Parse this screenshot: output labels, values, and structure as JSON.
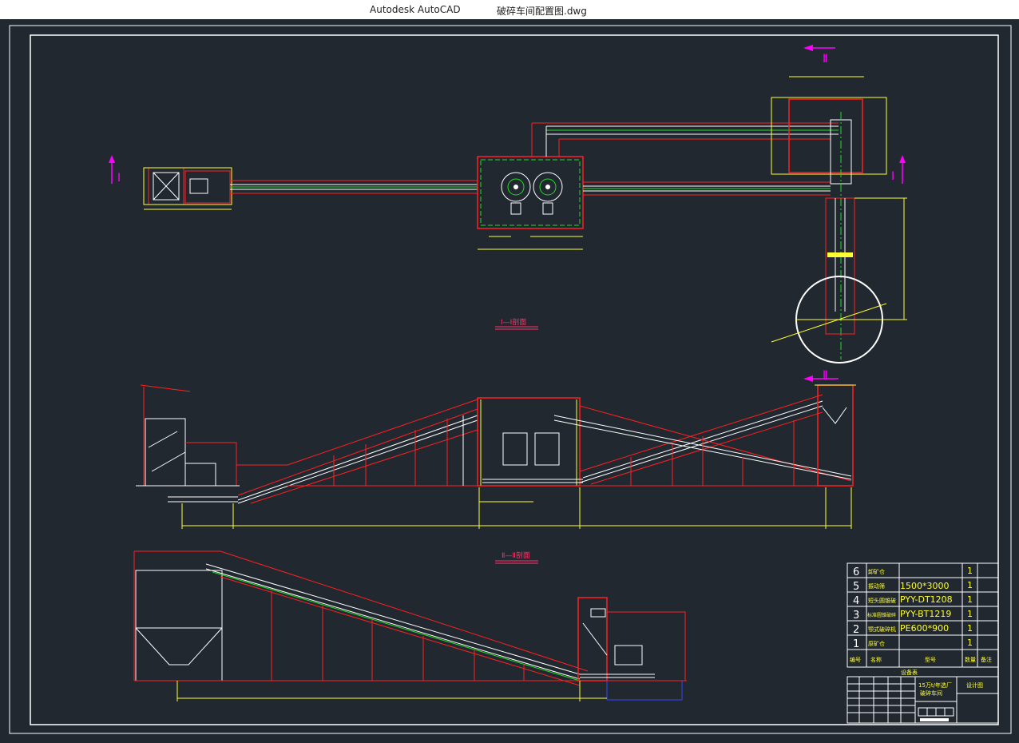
{
  "window": {
    "app_name": "Autodesk AutoCAD",
    "file_name": "破碎车间配置图.dwg"
  },
  "colors": {
    "background": "#212830",
    "frame": "#ffffff",
    "red": "#ff2020",
    "yellow": "#ffff33",
    "green": "#22dd22",
    "magenta": "#ff00ff",
    "white": "#ffffff",
    "blue": "#3344ff"
  },
  "drawing": {
    "section_markers": {
      "i_left": "I",
      "i_right": "I",
      "ii_top": "Ⅱ",
      "ii_bottom": "Ⅱ"
    },
    "section_titles": {
      "section_1": "I—I剖面",
      "section_2": "Ⅱ—Ⅱ剖面"
    }
  },
  "equipment_table": {
    "rows": [
      {
        "no": "6",
        "name": "卸矿仓",
        "spec": "",
        "qty": "1"
      },
      {
        "no": "5",
        "name": "振动筛",
        "spec": "1500*3000",
        "qty": "1"
      },
      {
        "no": "4",
        "name": "短头圆锥破",
        "spec": "PYY-DT1208",
        "qty": "1"
      },
      {
        "no": "3",
        "name": "标准圆锥破碎",
        "spec": "PYY-BT1219",
        "qty": "1"
      },
      {
        "no": "2",
        "name": "颚式破碎机",
        "spec": "PE600*900",
        "qty": "1"
      },
      {
        "no": "1",
        "name": "原矿仓",
        "spec": "",
        "qty": "1"
      }
    ],
    "header": {
      "no": "编号",
      "name": "名称",
      "spec": "型号",
      "qty": "数量",
      "note": "备注"
    },
    "caption": "设备表"
  },
  "title_block": {
    "project": "15万t/年选厂",
    "drawing": "破碎车间",
    "drawing_no": "设计图"
  }
}
